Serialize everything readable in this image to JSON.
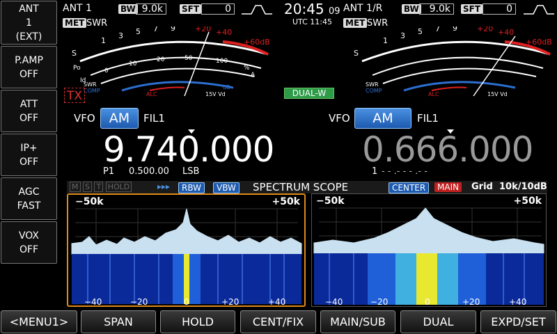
{
  "left_menu": [
    {
      "name": "ant",
      "line1": "ANT",
      "line2": "1",
      "line3": "(EXT)"
    },
    {
      "name": "pamp",
      "line1": "P.AMP",
      "line2": "OFF"
    },
    {
      "name": "att",
      "line1": "ATT",
      "line2": "OFF"
    },
    {
      "name": "ipplus",
      "line1": "IP+",
      "line2": "OFF"
    },
    {
      "name": "agc",
      "line1": "AGC",
      "line2": "FAST"
    },
    {
      "name": "vox",
      "line1": "VOX",
      "line2": "OFF"
    }
  ],
  "main": {
    "ant": "ANT 1",
    "bw_label": "BW",
    "bw_value": "9.0k",
    "sft_label": "SFT",
    "sft_value": "0",
    "met": "MET",
    "swr": "SWR",
    "tx": "TX",
    "vfo": "VFO",
    "mode": "AM",
    "fil": "FIL1",
    "freq": "9.740.000",
    "memo": "P1",
    "offset": "0.500.00",
    "sideband": "LSB"
  },
  "clock": {
    "time": "20:45",
    "sec": "09",
    "utc": "UTC 11:45"
  },
  "sub": {
    "ant": "ANT 1/R",
    "bw_label": "BW",
    "bw_value": "9.0k",
    "sft_label": "SFT",
    "sft_value": "0",
    "met": "MET",
    "swr": "SWR",
    "dualw": "DUAL-W",
    "vfo": "VFO",
    "mode": "AM",
    "fil": "FIL1",
    "freq": "0.666.000",
    "memo": "1",
    "memo_blank": "- - .- - - .- -"
  },
  "meter": {
    "s_scale": [
      "S",
      "1",
      "3",
      "5",
      "7",
      "9",
      "+20",
      "+40",
      "+60dB"
    ],
    "po_scale": [
      "Po",
      "0",
      "10",
      "20",
      "50",
      "100",
      "%"
    ],
    "id_scale": [
      "Id",
      "0",
      "5",
      "10",
      "15",
      "20",
      "25",
      "A"
    ],
    "swr_scale": [
      "SWR",
      "1",
      "1.5",
      "2",
      "3",
      "∞"
    ],
    "comp_scale": [
      "COMP",
      "0",
      "10",
      "20",
      "dB"
    ],
    "alc_label": "ALC",
    "vd_scale": [
      "10",
      "15V",
      "Vd"
    ]
  },
  "scope": {
    "indicators": [
      "M",
      "S",
      "T",
      "HOLD"
    ],
    "arrows": "▸▸▸",
    "rbw": "RBW",
    "vbw": "VBW",
    "title": "SPECTRUM SCOPE",
    "center": "CENTER",
    "main": "MAIN",
    "grid": "Grid",
    "grid_val": "10k/10dB",
    "left_span_l": "−50k",
    "left_span_r": "+50k",
    "right_span_l": "−50k",
    "right_span_r": "+50k",
    "ticks": [
      "−40",
      "−20",
      "0",
      "+20",
      "+40"
    ]
  },
  "bottom": [
    "<MENU1>",
    "SPAN",
    "HOLD",
    "CENT/FIX",
    "MAIN/SUB",
    "DUAL",
    "EXPD/SET"
  ],
  "colors": {
    "accent": "#4a90e0",
    "tx": "#e03030",
    "dualw": "#2e9b48",
    "scope_border": "#e08a1c",
    "red": "#e02020"
  }
}
